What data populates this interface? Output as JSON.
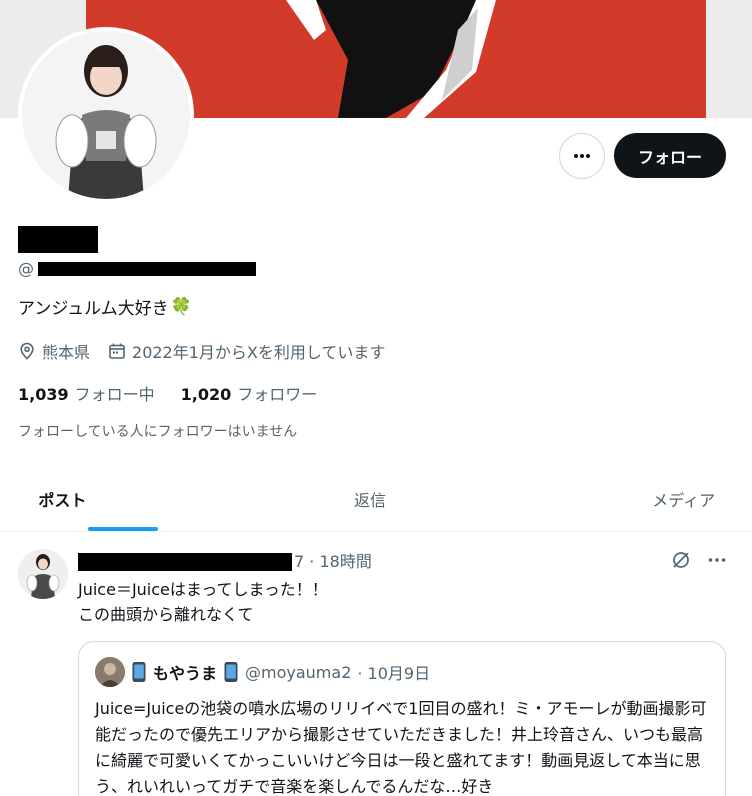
{
  "profile": {
    "handle_prefix": "@",
    "bio": "アンジュルム大好き",
    "bio_emoji": "🍀",
    "location": "熊本県",
    "joined": "2022年1月からXを利用しています",
    "following_count": "1,039",
    "following_label": "フォロー中",
    "followers_count": "1,020",
    "followers_label": "フォロワー",
    "no_known_followers": "フォローしている人にフォロワーはいません"
  },
  "actions": {
    "follow_label": "フォロー",
    "more_icon": "more-horizontal-icon"
  },
  "tabs": [
    {
      "label": "ポスト",
      "active": true
    },
    {
      "label": "返信",
      "active": false
    },
    {
      "label": "メディア",
      "active": false
    }
  ],
  "tweet": {
    "handle_tail": "7",
    "time": "· 18時間",
    "line1": "Juice＝Juiceはまってしまった！！",
    "line2": "この曲頭から離れなくて",
    "quote": {
      "name": "もやうま",
      "handle": "@moyauma2",
      "date": "· 10月9日",
      "text": "Juice=Juiceの池袋の噴水広場のリリイベで1回目の盛れ！ミ・アモーレが動画撮影可能だったので優先エリアから撮影させていただきました！井上玲音さん、いつも最高に綺麗で可愛いくてかっこいいけど今日は一段と盛れてます！動画見返して本当に思う、れいれいってガチで音楽を楽しんでるんだな…好き"
    }
  },
  "colors": {
    "banner_red": "#d23a2a",
    "accent": "#1d9bf0",
    "text_primary": "#0f1419",
    "text_secondary": "#536471"
  }
}
